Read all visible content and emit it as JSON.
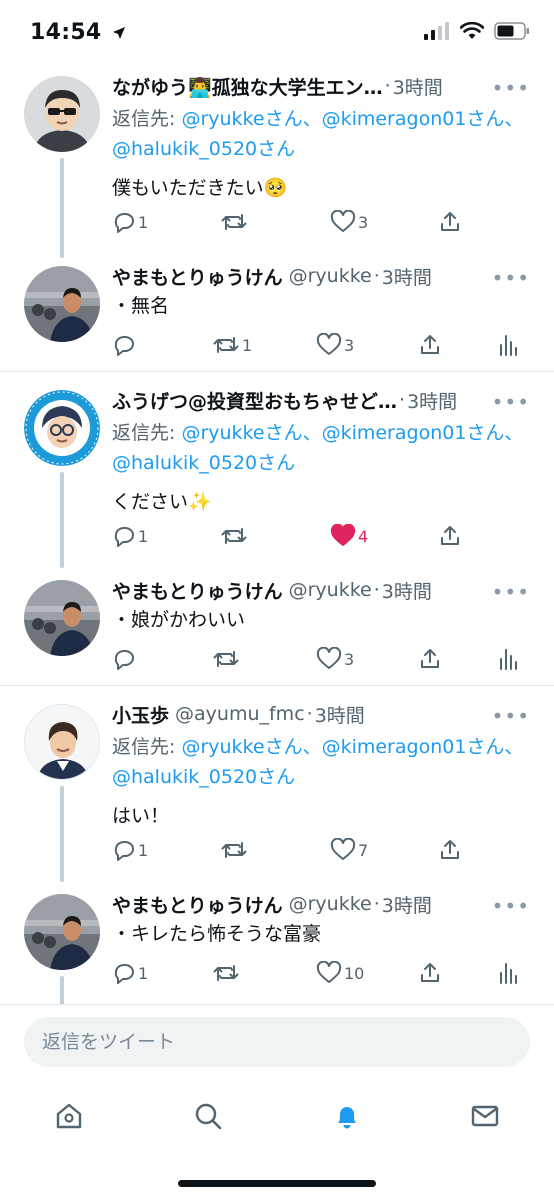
{
  "status_bar": {
    "time": "14:54"
  },
  "colors": {
    "accent": "#1d9bf0",
    "like": "#e0245e",
    "muted": "#536471"
  },
  "tweets": [
    {
      "name": "ながゆう👨‍💻孤独な大学生エン…",
      "handle": "",
      "time": "3時間",
      "reply_prefix": "返信先: ",
      "reply_mentions": "@ryukkeさん、@kimeragon01さん、@halukik_0520さん",
      "text": "僕もいただきたい🥺",
      "reply_count": "1",
      "retweet_count": "",
      "like_count": "3"
    },
    {
      "name": "やまもとりゅうけん",
      "handle": "@ryukke",
      "time": "3時間",
      "text": "・無名",
      "reply_count": "",
      "retweet_count": "1",
      "like_count": "3"
    },
    {
      "name": "ふうげつ@投資型おもちゃせど…",
      "handle": "",
      "time": "3時間",
      "reply_prefix": "返信先: ",
      "reply_mentions": "@ryukkeさん、@kimeragon01さん、@halukik_0520さん",
      "text": "ください✨",
      "reply_count": "1",
      "retweet_count": "",
      "like_count": "4"
    },
    {
      "name": "やまもとりゅうけん",
      "handle": "@ryukke",
      "time": "3時間",
      "text": "・娘がかわいい",
      "reply_count": "",
      "retweet_count": "",
      "like_count": "3"
    },
    {
      "name": "小玉歩",
      "handle": "@ayumu_fmc",
      "time": "3時間",
      "reply_prefix": "返信先: ",
      "reply_mentions": "@ryukkeさん、@kimeragon01さん、@halukik_0520さん",
      "text": "はい！",
      "reply_count": "1",
      "retweet_count": "",
      "like_count": "7"
    },
    {
      "name": "やまもとりゅうけん",
      "handle": "@ryukke",
      "time": "3時間",
      "text": "・キレたら怖そうな富豪",
      "reply_count": "1",
      "retweet_count": "",
      "like_count": "10"
    }
  ],
  "separator": "·",
  "compose": {
    "placeholder": "返信をツイート"
  },
  "tab_bar": {
    "active": "notifications"
  }
}
